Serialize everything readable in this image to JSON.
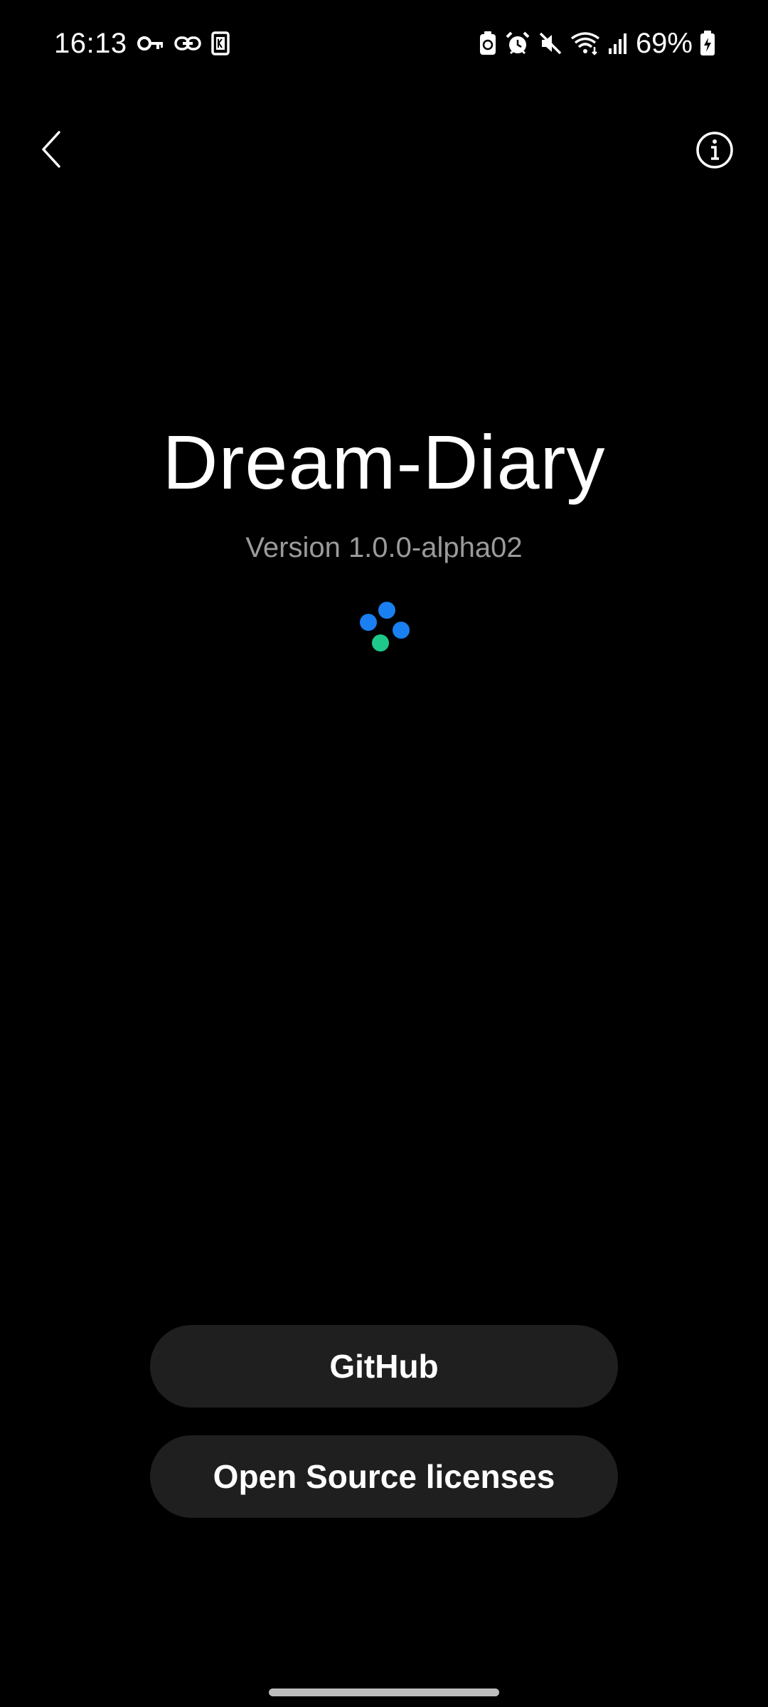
{
  "status_bar": {
    "time": "16:13",
    "battery_percent": "69%",
    "left_icons": [
      "key-icon",
      "link-icon",
      "k-app-icon"
    ],
    "right_icons": [
      "battery-saver-icon",
      "alarm-icon",
      "mute-icon",
      "wifi-icon",
      "signal-icon",
      "battery-charging-icon"
    ]
  },
  "app_bar": {
    "back_icon": "chevron-left-icon",
    "info_icon": "info-icon"
  },
  "about": {
    "title": "Dream-Diary",
    "version": "Version 1.0.0-alpha02",
    "loading_colors": {
      "blue": "#1a7ff0",
      "green": "#1ec88a"
    }
  },
  "buttons": {
    "github": "GitHub",
    "licenses": "Open Source licenses"
  },
  "colors": {
    "background": "#000000",
    "button_bg": "#1f1f1f",
    "version_text": "#9b9b9b"
  }
}
